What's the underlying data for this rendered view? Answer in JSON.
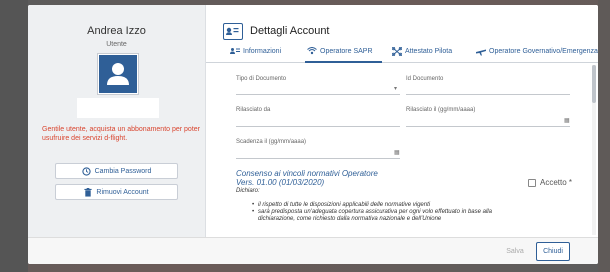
{
  "user": {
    "name": "Andrea Izzo",
    "role": "Utente",
    "warning": "Gentile utente, acquista un abbonamento per poter usufruire dei servizi d-flight.",
    "change_password_label": "Cambia Password",
    "remove_account_label": "Rimuovi Account"
  },
  "header": {
    "title": "Dettagli Account"
  },
  "tabs": [
    {
      "label": "Informazioni",
      "icon": "person-list-icon"
    },
    {
      "label": "Operatore SAPR",
      "icon": "antenna-icon"
    },
    {
      "label": "Attestato Pilota",
      "icon": "drone-icon"
    },
    {
      "label": "Operatore Governativo/Emergenza",
      "icon": "plane-icon"
    }
  ],
  "active_tab": "Operatore SAPR",
  "form": {
    "tipo_documento_label": "Tipo di Documento",
    "id_documento_label": "Id Documento",
    "rilasciato_da_label": "Rilasciato da",
    "rilasciato_il_label": "Rilasciato il (gg/mm/aaaa)",
    "scadenza_label": "Scadenza il (gg/mm/aaaa)"
  },
  "consenso": {
    "title": "Consenso ai vincoli normativi Operatore",
    "version": "Vers. 01.00 (01/03/2020)",
    "dichiaro": "Dichiaro:",
    "items": [
      "il rispetto di tutte le disposizioni applicabili delle normative vigenti",
      "sarà predisposta un'adeguata copertura assicurativa per ogni volo effettuato in base alla dichiarazione, come richiesto dalla normativa nazionale e dell'Unione"
    ],
    "accetto_label": "Accetto *"
  },
  "footer": {
    "save_label": "Salva",
    "close_label": "Chiudi"
  },
  "colors": {
    "accent": "#2f5f97",
    "warning": "#d9452f"
  }
}
